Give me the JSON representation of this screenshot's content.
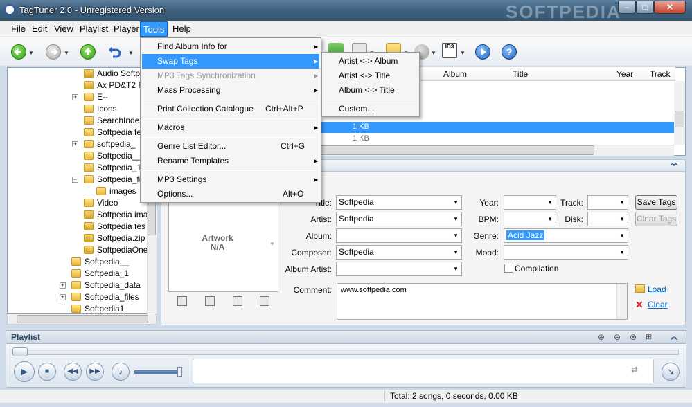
{
  "window": {
    "title": "TagTuner 2.0 - Unregistered Version",
    "watermark": "SOFTPEDIA",
    "controls": {
      "minimize": "–",
      "maximize": "□",
      "close": "✕"
    }
  },
  "menubar": [
    "File",
    "Edit",
    "View",
    "Playlist",
    "Player",
    "Tools",
    "Help"
  ],
  "toolbar": {
    "icons": [
      "back-icon",
      "forward-icon",
      "up-icon",
      "undo-icon",
      "scan-icon",
      "tag-icon",
      "folder-icon",
      "refresh-icon",
      "id3-icon",
      "play-icon",
      "help-icon"
    ]
  },
  "tree": {
    "items": [
      "Audio Softpe",
      "Ax PD&T2 FS",
      "E--",
      "Icons",
      "SearchIndex",
      "Softpedia te",
      "softpedia_",
      "Softpedia__",
      "Softpedia_1",
      "Softpedia_fil",
      "images",
      "Video",
      "Softpedia ima",
      "Softpedia tes",
      "Softpedia.zip",
      "SoftpediaOne",
      "Softpedia__",
      "Softpedia_1",
      "Softpedia_data",
      "Softpedia_files",
      "Softpedia1"
    ]
  },
  "filelist": {
    "columns": [
      "Album",
      "Title",
      "Year",
      "Track"
    ],
    "rows": [
      {
        "size": "1 KB",
        "selected": true
      },
      {
        "size": "1 KB",
        "selected": false
      }
    ]
  },
  "editor": {
    "artwork": {
      "line1": "Artwork",
      "line2": "N/A"
    },
    "labels": {
      "title": "Title:",
      "artist": "Artist:",
      "album": "Album:",
      "composer": "Composer:",
      "album_artist": "Album Artist:",
      "comment": "Comment:",
      "year": "Year:",
      "bpm": "BPM:",
      "genre": "Genre:",
      "mood": "Mood:",
      "track": "Track:",
      "disk": "Disk:"
    },
    "values": {
      "title": "Softpedia",
      "artist": "Softpedia",
      "album": "",
      "composer": "Softpedia",
      "album_artist": "",
      "year": "",
      "bpm": "",
      "genre": "Acid Jazz",
      "mood": "",
      "track": "",
      "disk": "",
      "comment": "www.softpedia.com"
    },
    "compilation_label": "Compilation",
    "compilation_checked": false,
    "buttons": {
      "save": "Save Tags",
      "clear_tags": "Clear Tags"
    },
    "links": {
      "load": "Load",
      "clear": "Clear"
    }
  },
  "playlist": {
    "label": "Playlist"
  },
  "status": {
    "text": "Total: 2 songs, 0 seconds, 0.00 KB"
  },
  "tools_menu": {
    "items": [
      {
        "label": "Find Album Info for",
        "submenu": true
      },
      {
        "label": "Swap Tags",
        "submenu": true,
        "highlighted": true
      },
      {
        "label": "MP3 Tags Synchronization",
        "submenu": true,
        "disabled": true
      },
      {
        "label": "Mass Processing",
        "submenu": true
      },
      {
        "label": "Print Collection Catalogue",
        "shortcut": "Ctrl+Alt+P"
      },
      {
        "label": "Macros",
        "submenu": true
      },
      {
        "label": "Genre List Editor...",
        "shortcut": "Ctrl+G"
      },
      {
        "label": "Rename Templates",
        "submenu": true
      },
      {
        "label": "MP3 Settings",
        "submenu": true
      },
      {
        "label": "Options...",
        "shortcut": "Alt+O"
      }
    ]
  },
  "swap_menu": {
    "items": [
      "Artist <-> Album",
      "Artist <-> Title",
      "Album <-> Title",
      "Custom..."
    ]
  },
  "colors": {
    "accent": "#3399ff",
    "titlebar": "#3f6282",
    "link": "#0066cc"
  }
}
